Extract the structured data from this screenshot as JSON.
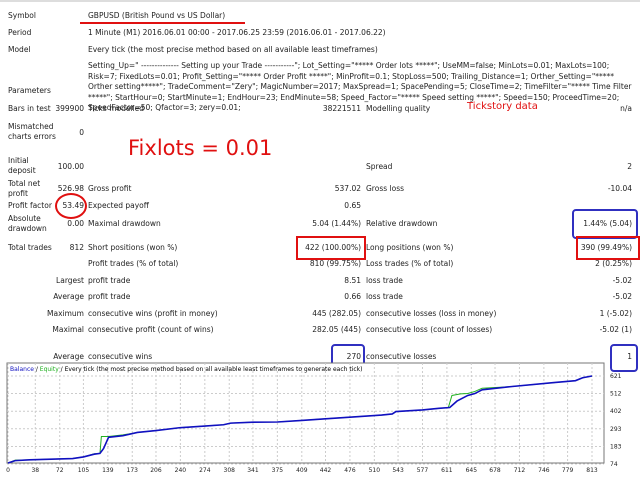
{
  "header": {
    "symbol_label": "Symbol",
    "symbol": "GBPUSD (British Pound vs US Dollar)",
    "period_label": "Period",
    "period": "1 Minute (M1) 2016.06.01 00:00 - 2017.06.25 23:59 (2016.06.01 - 2017.06.22)",
    "model_label": "Model",
    "model": "Every tick (the most precise method based on all available least timeframes)",
    "parameters_label": "Parameters",
    "parameters": "Setting_Up=\" -------------- Setting up your Trade -----------\"; Lot_Setting=\"***** Order lots *****\"; UseMM=false; MinLots=0.01; MaxLots=100; Risk=7; FixedLots=0.01; Profit_Setting=\"***** Order Profit *****\"; MinProfit=0.1; StopLoss=500; Trailing_Distance=1; Orther_Setting=\"***** Orther setting*****\"; TradeComment=\"Zery\"; MagicNumber=2017; MaxSpread=1; SpacePending=5; CloseTime=2; TimeFilter=\"***** Time Filter *****\"; StartHour=0; StartMinute=1; EndHour=23; EndMinute=58; Speed_Factor=\"***** Speed setting *****\"; Speed=150; ProceedTime=20; SpeedFactor=50; Qfactor=3; zery=0.01;"
  },
  "annotations": {
    "tickstory": "Tickstory data",
    "fixlots": "Fixlots = 0.01"
  },
  "stats": {
    "bars_label": "Bars in test",
    "bars": "399900",
    "ticks_label": "Ticks modelled",
    "ticks": "38221511",
    "quality_label": "Modelling quality",
    "quality": "n/a",
    "mismatch_label": "Mismatched charts errors",
    "mismatch": "0",
    "deposit_label": "Initial deposit",
    "deposit": "100.00",
    "spread_label": "Spread",
    "spread": "2",
    "netprofit_label": "Total net profit",
    "netprofit": "526.98",
    "grossprofit_label": "Gross profit",
    "grossprofit": "537.02",
    "grossloss_label": "Gross loss",
    "grossloss": "-10.04",
    "pf_label": "Profit factor",
    "pf": "53.49",
    "payoff_label": "Expected payoff",
    "payoff": "0.65",
    "absdd_label": "Absolute drawdown",
    "absdd": "0.00",
    "maxdd_label": "Maximal drawdown",
    "maxdd": "5.04 (1.44%)",
    "reldd_label": "Relative drawdown",
    "reldd": "1.44% (5.04)",
    "trades_label": "Total trades",
    "trades": "812",
    "short_label": "Short positions (won %)",
    "short": "422 (100.00%)",
    "long_label": "Long positions (won %)",
    "long": "390 (99.49%)",
    "profittrades_label": "Profit trades (% of total)",
    "profittrades": "810 (99.75%)",
    "losstrades_label": "Loss trades (% of total)",
    "losstrades": "2 (0.25%)",
    "largest_label": "Largest",
    "largest_profit_label": "profit trade",
    "largest_profit": "8.51",
    "largest_loss_label": "loss trade",
    "largest_loss": "-5.02",
    "average_label": "Average",
    "avg_profit_label": "profit trade",
    "avg_profit": "0.66",
    "avg_loss_label": "loss trade",
    "avg_loss": "-5.02",
    "maximum_label": "Maximum",
    "max_wins_label": "consecutive wins (profit in money)",
    "max_wins": "445 (282.05)",
    "max_losses_label": "consecutive losses (loss in money)",
    "max_losses": "1 (-5.02)",
    "maximal_label": "Maximal",
    "maximal_profit_label": "consecutive profit (count of wins)",
    "maximal_profit": "282.05 (445)",
    "maximal_loss_label": "consecutive loss (count of losses)",
    "maximal_loss": "-5.02 (1)",
    "average2_label": "Average",
    "avg_wins_label": "consecutive wins",
    "avg_wins": "270",
    "avg_losses_label": "consecutive losses",
    "avg_losses": "1"
  },
  "chart_data": {
    "type": "line",
    "legend": {
      "balance": "Balance",
      "sep1": " / ",
      "equity": "Equity",
      "rest": " / Every tick (the most precise method based on all available least timeframes to generate each tick)"
    },
    "colors": {
      "balance": "#1010c0",
      "equity": "#20b020"
    },
    "x_ticks": [
      0,
      38,
      72,
      105,
      139,
      173,
      206,
      240,
      274,
      308,
      341,
      375,
      409,
      442,
      476,
      510,
      543,
      577,
      611,
      645,
      678,
      712,
      746,
      779,
      813
    ],
    "y_ticks": [
      74,
      183,
      293,
      402,
      512,
      621
    ],
    "xlim": [
      0,
      830
    ],
    "ylim": [
      74,
      621
    ],
    "series": [
      {
        "name": "Balance",
        "x": [
          0,
          10,
          30,
          60,
          90,
          105,
          120,
          128,
          133,
          140,
          160,
          180,
          206,
          240,
          274,
          300,
          310,
          341,
          375,
          409,
          442,
          476,
          520,
          535,
          540,
          577,
          600,
          615,
          625,
          640,
          650,
          660,
          700,
          760,
          790,
          800,
          813
        ],
        "y": [
          80,
          95,
          100,
          104,
          108,
          118,
          135,
          140,
          170,
          240,
          250,
          270,
          282,
          300,
          310,
          318,
          328,
          334,
          335,
          345,
          355,
          365,
          378,
          385,
          400,
          410,
          420,
          425,
          465,
          500,
          512,
          535,
          555,
          580,
          592,
          610,
          621
        ]
      },
      {
        "name": "Equity",
        "x": [
          0,
          10,
          30,
          60,
          90,
          105,
          120,
          128,
          130,
          140,
          160,
          180,
          206,
          240,
          274,
          300,
          310,
          341,
          375,
          409,
          442,
          476,
          520,
          535,
          540,
          577,
          600,
          613,
          618,
          630,
          640,
          650,
          660,
          700,
          760,
          790,
          800,
          813
        ],
        "y": [
          80,
          98,
          100,
          104,
          108,
          118,
          138,
          140,
          245,
          245,
          255,
          270,
          282,
          300,
          310,
          318,
          328,
          334,
          335,
          345,
          355,
          365,
          378,
          385,
          400,
          410,
          420,
          425,
          500,
          510,
          512,
          525,
          545,
          555,
          580,
          592,
          610,
          621
        ]
      }
    ]
  }
}
